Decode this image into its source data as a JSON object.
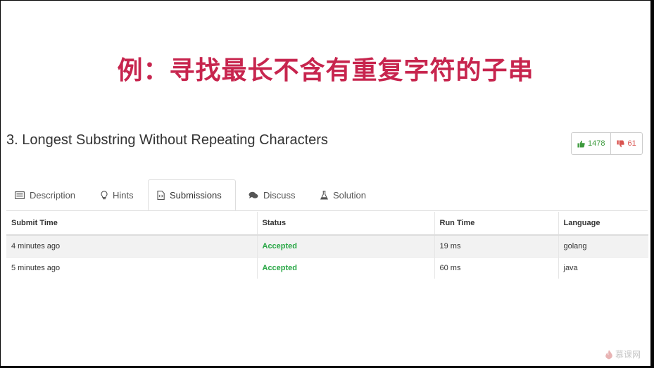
{
  "slide": {
    "title": "例：寻找最长不含有重复字符的子串",
    "title_color": "#c7254e"
  },
  "problem": {
    "title": "3. Longest Substring Without Repeating Characters",
    "likes": "1478",
    "dislikes": "61",
    "like_icon": "thumbs-up-icon",
    "dislike_icon": "thumbs-down-icon"
  },
  "tabs": [
    {
      "label": "Description",
      "icon": "description-icon",
      "active": false
    },
    {
      "label": "Hints",
      "icon": "lightbulb-icon",
      "active": false
    },
    {
      "label": "Submissions",
      "icon": "code-file-icon",
      "active": true
    },
    {
      "label": "Discuss",
      "icon": "chat-bubbles-icon",
      "active": false
    },
    {
      "label": "Solution",
      "icon": "flask-icon",
      "active": false
    }
  ],
  "submissions": {
    "columns": [
      "Submit Time",
      "Status",
      "Run Time",
      "Language"
    ],
    "rows": [
      {
        "submit_time": "4 minutes ago",
        "status": "Accepted",
        "run_time": "19 ms",
        "language": "golang"
      },
      {
        "submit_time": "5 minutes ago",
        "status": "Accepted",
        "run_time": "60 ms",
        "language": "java"
      }
    ],
    "accepted_color": "#28a745"
  },
  "watermark": {
    "text": "慕课网"
  }
}
